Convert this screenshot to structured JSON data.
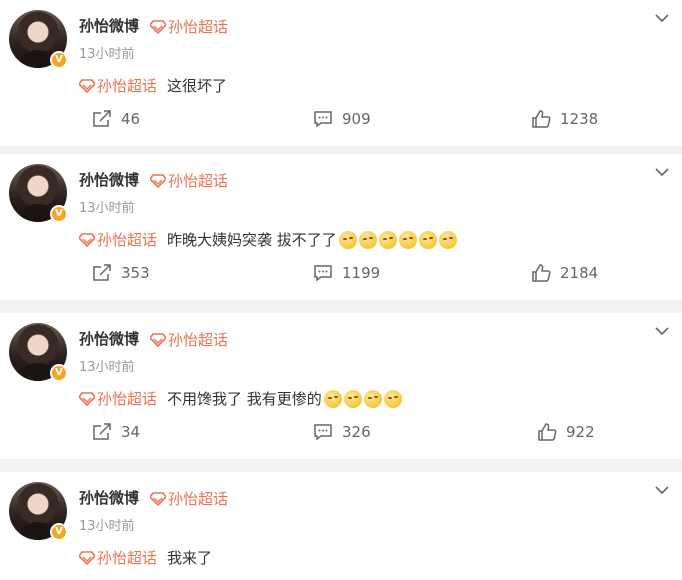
{
  "colors": {
    "topic": "#eb7350",
    "badge": "#f5a623",
    "text": "#333333",
    "muted": "#999999"
  },
  "posts": [
    {
      "author": "孙怡微博",
      "badge": "V",
      "topic_tag": "孙怡超话",
      "time": "13小时前",
      "topic": "孙怡超话",
      "text": "这很坏了",
      "emoji_count": 0,
      "shares": "46",
      "comments": "909",
      "likes": "1238"
    },
    {
      "author": "孙怡微博",
      "badge": "V",
      "topic_tag": "孙怡超话",
      "time": "13小时前",
      "topic": "孙怡超话",
      "text": "昨晚大姨妈突袭 拔不了了",
      "emoji_count": 6,
      "shares": "353",
      "comments": "1199",
      "likes": "2184"
    },
    {
      "author": "孙怡微博",
      "badge": "V",
      "topic_tag": "孙怡超话",
      "time": "13小时前",
      "topic": "孙怡超话",
      "text": "不用馋我了 我有更惨的",
      "emoji_count": 4,
      "shares": "34",
      "comments": "326",
      "likes": "922"
    },
    {
      "author": "孙怡微博",
      "badge": "V",
      "topic_tag": "孙怡超话",
      "time": "13小时前",
      "topic": "孙怡超话",
      "text": "我来了",
      "emoji_count": 0
    }
  ]
}
